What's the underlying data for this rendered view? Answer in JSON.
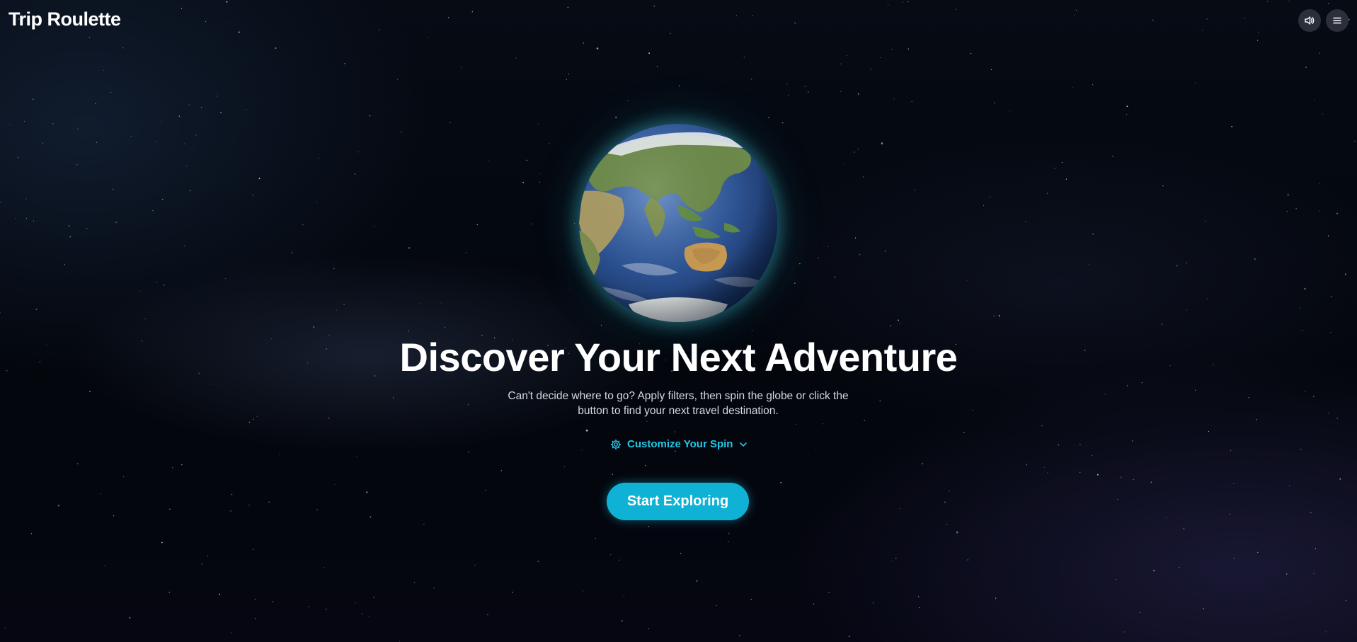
{
  "header": {
    "brand": "Trip Roulette",
    "sound_icon": "speaker-icon",
    "menu_icon": "hamburger-menu-icon"
  },
  "hero": {
    "headline": "Discover Your Next Adventure",
    "subtitle": "Can't decide where to go? Apply filters, then spin the globe or click the button to find your next travel destination.",
    "customize_label": "Customize Your Spin",
    "customize_icon": "gear-icon",
    "customize_chevron": "chevron-down-icon",
    "cta_label": "Start Exploring"
  },
  "colors": {
    "accent": "#22c8e6",
    "button": "#0fb2d4",
    "background": "#03060c"
  }
}
